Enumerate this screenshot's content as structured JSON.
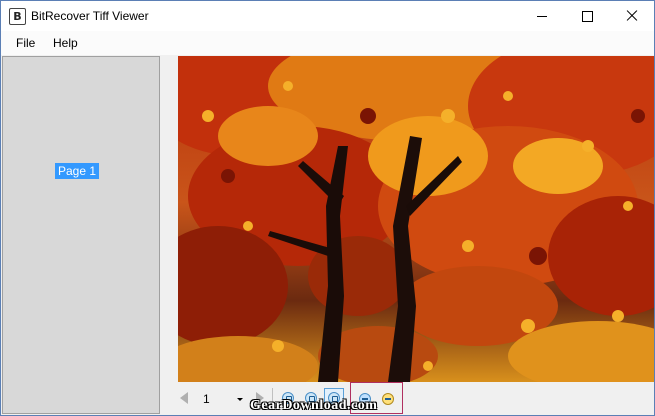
{
  "window": {
    "title": "BitRecover Tiff Viewer",
    "app_icon_letter": "B"
  },
  "menu": {
    "items": [
      {
        "label": "File"
      },
      {
        "label": "Help"
      }
    ]
  },
  "sidebar": {
    "thumbnails": [
      {
        "label": "Page 1",
        "selected": true
      }
    ],
    "background": "#d8d8d8",
    "selected_color": "#3399ff"
  },
  "toolbar": {
    "page_number": "1"
  },
  "watermark": {
    "text": "GearDownload.com"
  },
  "colors": {
    "window_border": "#5b7fb5",
    "zoom_group_border": "#b03060",
    "image_dominant": "#c83a10"
  }
}
